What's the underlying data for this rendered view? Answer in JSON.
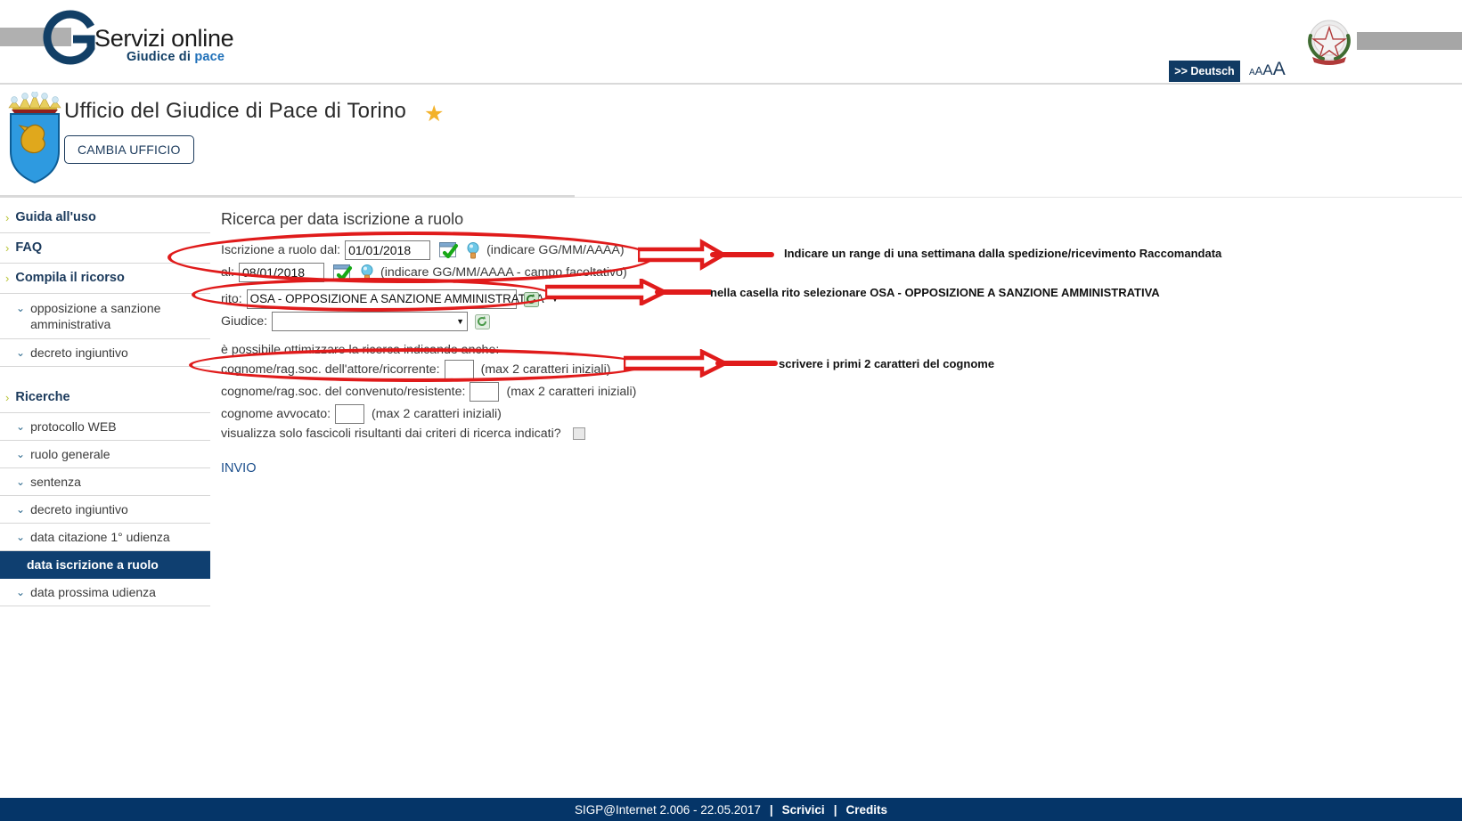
{
  "header": {
    "logo_line1": "Servizi online",
    "logo_line2_a": "Giudice di ",
    "logo_line2_b": "pace",
    "lang_button": ">> Deutsch",
    "font_size_small": "A",
    "font_size_medium": "A",
    "font_size_large": "A",
    "font_size_xlarge": "A",
    "emblem_alt": "emblem-republic-italy-icon"
  },
  "office": {
    "title": "Ufficio del Giudice di Pace di Torino",
    "star": "★",
    "change_office_button": "CAMBIA UFFICIO"
  },
  "sidebar": {
    "items": [
      {
        "label": "Guida all'uso",
        "level": "top",
        "active": false
      },
      {
        "label": "FAQ",
        "level": "top",
        "active": false
      },
      {
        "label": "Compila il ricorso",
        "level": "top",
        "active": false
      },
      {
        "label": "opposizione a sanzione amministrativa",
        "level": "sub",
        "active": false
      },
      {
        "label": "decreto ingiuntivo",
        "level": "sub",
        "active": false
      },
      {
        "label": "Ricerche",
        "level": "top",
        "active": false
      },
      {
        "label": "protocollo WEB",
        "level": "sub",
        "active": false
      },
      {
        "label": "ruolo generale",
        "level": "sub",
        "active": false
      },
      {
        "label": "sentenza",
        "level": "sub",
        "active": false
      },
      {
        "label": "decreto ingiuntivo",
        "level": "sub",
        "active": false
      },
      {
        "label": "data citazione 1° udienza",
        "level": "sub",
        "active": false
      },
      {
        "label": "data iscrizione a ruolo",
        "level": "sub",
        "active": true
      },
      {
        "label": "data prossima udienza",
        "level": "sub",
        "active": false
      }
    ]
  },
  "form": {
    "title": "Ricerca per data iscrizione a ruolo",
    "date_from_label": "Iscrizione a ruolo dal:",
    "date_from_value": "01/01/2018",
    "date_from_hint": "(indicare GG/MM/AAAA)",
    "date_to_label": "al:",
    "date_to_value": "08/01/2018",
    "date_to_hint": "(indicare GG/MM/AAAA - campo facoltativo)",
    "rito_label": "rito:",
    "rito_value": "OSA - OPPOSIZIONE A SANZIONE AMMINISTRATIVA",
    "giudice_label": "Giudice:",
    "giudice_value": "",
    "optimize_text": "è possibile ottimizzare la ricerca indicando anche:",
    "attore_label": "cognome/rag.soc. dell'attore/ricorrente:",
    "attore_value": "",
    "attore_hint": "(max 2 caratteri iniziali)",
    "convenuto_label": "cognome/rag.soc. del convenuto/resistente:",
    "convenuto_value": "",
    "convenuto_hint": "(max 2 caratteri iniziali)",
    "avvocato_label": "cognome avvocato:",
    "avvocato_value": "",
    "avvocato_hint": "(max 2 caratteri iniziali)",
    "only_results_label": "visualizza solo fascicoli risultanti dai criteri di ricerca indicati?",
    "submit_label": "INVIO"
  },
  "annotations": [
    {
      "text": "Indicare un range di una settimana dalla spedizione/ricevimento Raccomandata"
    },
    {
      "text": "nella casella rito selezionare OSA - OPPOSIZIONE A SANZIONE AMMINISTRATIVA"
    },
    {
      "text": "scrivere i primi 2 caratteri del cognome"
    }
  ],
  "footer": {
    "version": "SIGP@Internet 2.006 - 22.05.2017",
    "sep1": "|",
    "link1": "Scrivici",
    "sep2": "|",
    "link2": "Credits"
  },
  "colors": {
    "navy": "#053568",
    "accent_red": "#e01b1b",
    "sidebar_active": "#0f3f70",
    "link_blue": "#1b4e8c"
  }
}
